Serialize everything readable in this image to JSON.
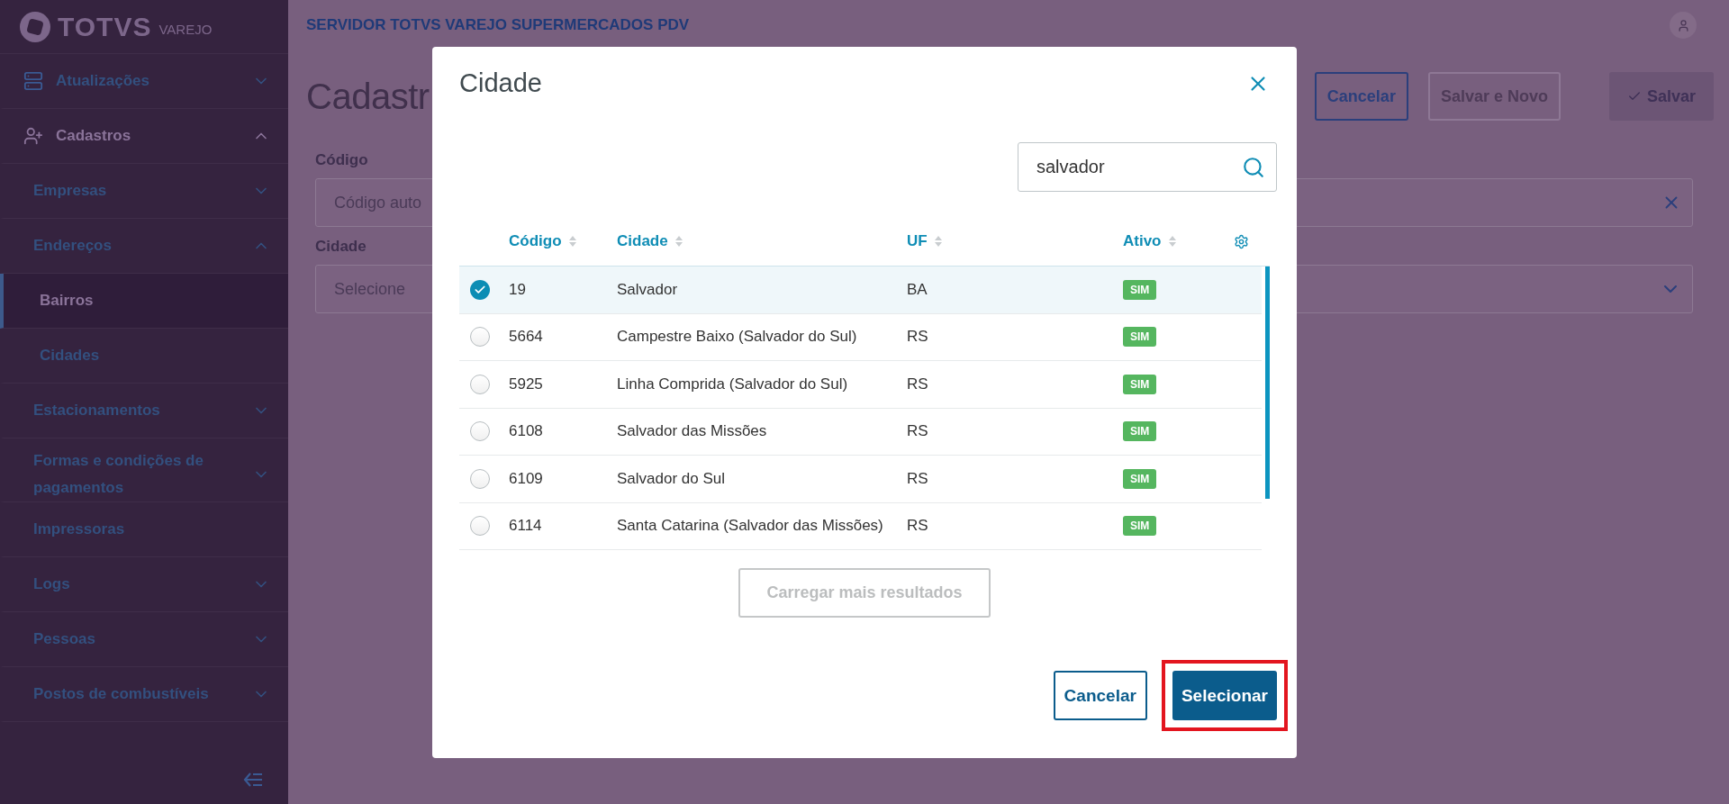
{
  "sidebar": {
    "logo": {
      "brand": "TOTVS",
      "sub": "VAREJO"
    },
    "items": [
      {
        "label": "Atualizações",
        "kind": "folder",
        "expanded": false,
        "selected": false
      },
      {
        "label": "Cadastros",
        "kind": "folder",
        "expanded": true,
        "selected": false,
        "children": [
          {
            "label": "Empresas",
            "kind": "folder",
            "expanded": false,
            "selected": false
          },
          {
            "label": "Endereços",
            "kind": "folder",
            "expanded": true,
            "selected": false,
            "children": [
              {
                "label": "Bairros",
                "kind": "link",
                "selected": true
              },
              {
                "label": "Cidades",
                "kind": "link",
                "selected": false
              }
            ]
          },
          {
            "label": "Estacionamentos",
            "kind": "folder",
            "expanded": false,
            "selected": false
          },
          {
            "label": "Formas e condições de pagamentos",
            "kind": "folder",
            "expanded": false,
            "selected": false
          },
          {
            "label": "Impressoras",
            "kind": "link",
            "selected": false
          },
          {
            "label": "Logs",
            "kind": "folder",
            "expanded": false,
            "selected": false
          },
          {
            "label": "Pessoas",
            "kind": "folder",
            "expanded": false,
            "selected": false
          },
          {
            "label": "Postos de combustíveis",
            "kind": "folder",
            "expanded": false,
            "selected": false
          }
        ]
      }
    ]
  },
  "header": {
    "title": "SERVIDOR TOTVS VAREJO SUPERMERCADOS PDV"
  },
  "page": {
    "title": "Cadastr",
    "actions": [
      {
        "label": "Cancelar",
        "kind": "outline"
      },
      {
        "label": "Salvar e Novo",
        "kind": "disabled"
      },
      {
        "label": "Salvar",
        "kind": "primary"
      }
    ],
    "fields": [
      {
        "label": "Código",
        "placeholder": "Código auto",
        "kind": "text"
      },
      {
        "label": "Cidade",
        "placeholder": "Selecione",
        "kind": "select"
      }
    ]
  },
  "modal": {
    "title": "Cidade",
    "search": {
      "value": "salvador"
    },
    "columns": [
      {
        "label": "Código"
      },
      {
        "label": "Cidade"
      },
      {
        "label": "UF"
      },
      {
        "label": "Ativo"
      }
    ],
    "rows": [
      {
        "selected": true,
        "cells": [
          "19",
          "Salvador",
          "BA"
        ],
        "active": "SIM"
      },
      {
        "selected": false,
        "cells": [
          "5664",
          "Campestre Baixo (Salvador do Sul)",
          "RS"
        ],
        "active": "SIM"
      },
      {
        "selected": false,
        "cells": [
          "5925",
          "Linha Comprida (Salvador do Sul)",
          "RS"
        ],
        "active": "SIM"
      },
      {
        "selected": false,
        "cells": [
          "6108",
          "Salvador das Missões",
          "RS"
        ],
        "active": "SIM"
      },
      {
        "selected": false,
        "cells": [
          "6109",
          "Salvador do Sul",
          "RS"
        ],
        "active": "SIM"
      },
      {
        "selected": false,
        "cells": [
          "6114",
          "Santa Catarina (Salvador das Missões)",
          "RS"
        ],
        "active": "SIM"
      }
    ],
    "load_more": {
      "label": "Carregar mais resultados",
      "disabled": true
    },
    "buttons": [
      {
        "label": "Cancelar",
        "kind": "outline",
        "highlighted": false
      },
      {
        "label": "Selecionar",
        "kind": "primary",
        "highlighted": true
      }
    ]
  }
}
